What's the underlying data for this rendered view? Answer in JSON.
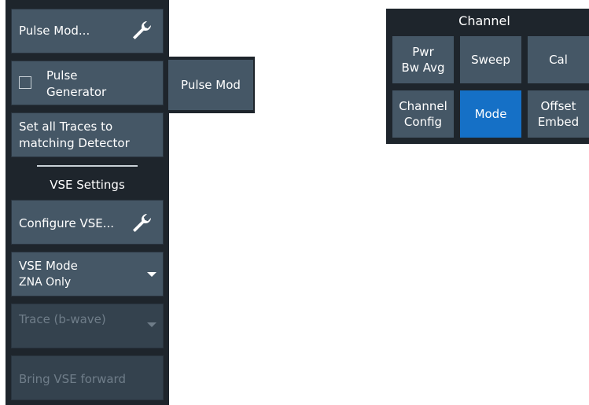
{
  "left_menu": {
    "pulse_mod_button": "Pulse Mod...",
    "pulse_generator_line1": "Pulse",
    "pulse_generator_line2": "Generator",
    "set_all_traces_line1": "Set all Traces to",
    "set_all_traces_line2": "matching Detector",
    "vse_settings_header": "VSE Settings",
    "configure_vse_button": "Configure VSE...",
    "vse_mode_label": "VSE Mode",
    "vse_mode_value": "ZNA Only",
    "trace_label": "Trace (b-wave)",
    "bring_vse_forward": "Bring VSE forward"
  },
  "flyout": {
    "label": "Pulse Mod"
  },
  "channel_panel": {
    "title": "Channel",
    "buttons": [
      {
        "line1": "Pwr",
        "line2": "Bw Avg"
      },
      {
        "line1": "Sweep",
        "line2": ""
      },
      {
        "line1": "Cal",
        "line2": ""
      },
      {
        "line1": "Channel",
        "line2": "Config"
      },
      {
        "line1": "Mode",
        "line2": ""
      },
      {
        "line1": "Offset",
        "line2": "Embed"
      }
    ]
  },
  "colors": {
    "panel_bg": "#1e252c",
    "button_bg": "#455766",
    "active_bg": "#1570c6",
    "disabled_text": "#6f7d89"
  },
  "icons": [
    "wrench-icon",
    "dropdown-caret-icon",
    "checkbox-icon"
  ]
}
